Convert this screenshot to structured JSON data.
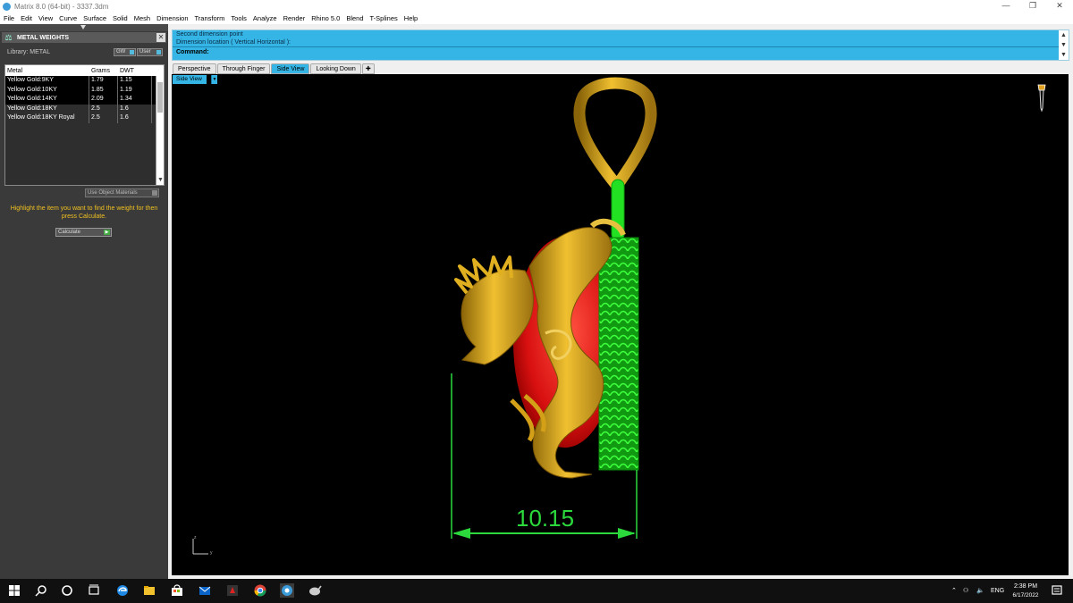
{
  "window": {
    "title": "Matrix 8.0 (64-bit) - 3337.3dm",
    "controls": [
      "—",
      "❐",
      "✕"
    ]
  },
  "menu": [
    "File",
    "Edit",
    "View",
    "Curve",
    "Surface",
    "Solid",
    "Mesh",
    "Dimension",
    "Transform",
    "Tools",
    "Analyze",
    "Render",
    "Rhino 5.0",
    "Blend",
    "T-Splines",
    "Help"
  ],
  "panel": {
    "title": "METAL WEIGHTS",
    "library_label": "Library: METAL",
    "gw_button": "GW",
    "user_button": "User",
    "columns": [
      "Metal",
      "Grams",
      "DWT"
    ],
    "rows": [
      {
        "metal": "Yellow Gold:9KY",
        "grams": "1.79",
        "dwt": "1.15"
      },
      {
        "metal": "Yellow Gold:10KY",
        "grams": "1.85",
        "dwt": "1.19"
      },
      {
        "metal": "Yellow Gold:14KY",
        "grams": "2.09",
        "dwt": "1.34"
      },
      {
        "metal": "Yellow Gold:18KY",
        "grams": "2.5",
        "dwt": "1.6"
      },
      {
        "metal": "Yellow Gold:18KY Royal",
        "grams": "2.5",
        "dwt": "1.6"
      }
    ],
    "use_object_materials": "Use Object Materials",
    "hint": "Highlight the item you want to find the weight for then press Calculate.",
    "calculate": "Calculate"
  },
  "command": {
    "history_1": "Second dimension point",
    "history_2": "Dimension location ( Vertical  Horizontal ):",
    "prompt": "Command:"
  },
  "tabs": [
    "Perspective",
    "Through Finger",
    "Side View",
    "Looking Down"
  ],
  "active_tab": "Side View",
  "viewport": {
    "label": "Side View",
    "dimension_value": "10.15",
    "axis_z": "z",
    "axis_y": "y",
    "colors": {
      "gold": "#d4a017",
      "gem_red": "#e01010",
      "mesh_green": "#22ee22",
      "dimension_green": "#2bd93d",
      "accent_blue": "#35b5e5"
    }
  },
  "taskbar": {
    "icons": [
      "windows-start-icon",
      "search-icon",
      "cortana-icon",
      "task-view-icon",
      "edge-icon",
      "file-explorer-icon",
      "store-icon",
      "mail-icon",
      "app-red-icon",
      "chrome-icon",
      "matrix-icon",
      "rhino-icon"
    ],
    "language": "ENG",
    "time": "2:38 PM",
    "date": "6/17/2022"
  }
}
